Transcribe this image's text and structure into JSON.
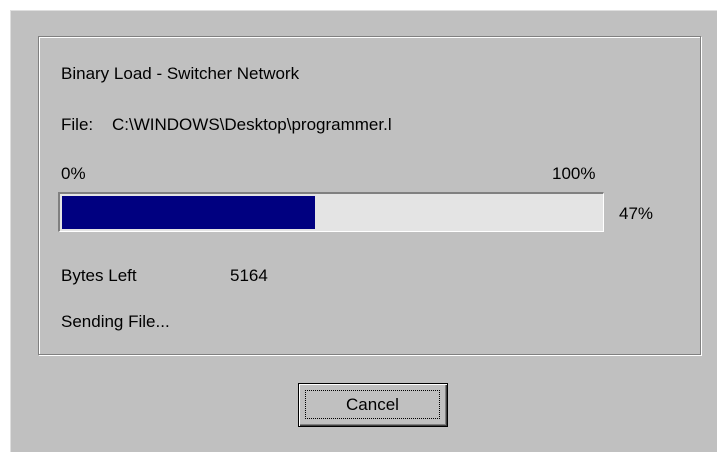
{
  "dialog": {
    "title_line": "Binary Load - Switcher Network",
    "file_label": "File:",
    "file_path": "C:\\WINDOWS\\Desktop\\programmer.l",
    "progress": {
      "min_label": "0%",
      "max_label": "100%",
      "value_label": "47%",
      "fraction": 0.47,
      "fill_color": "#000080"
    },
    "bytes_left_label": "Bytes Left",
    "bytes_left_value": "5164",
    "status": "Sending File...",
    "cancel_label": "Cancel"
  }
}
